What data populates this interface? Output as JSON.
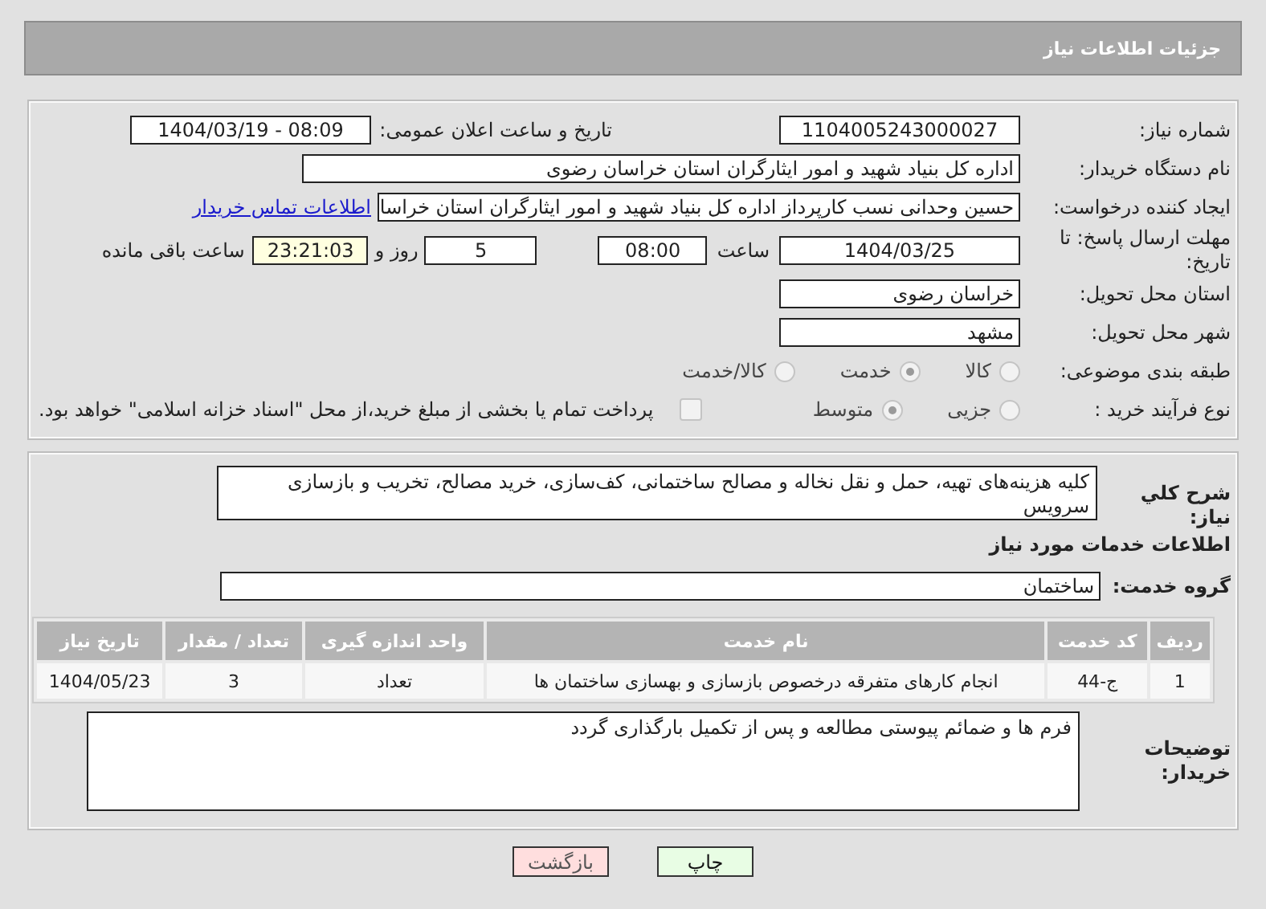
{
  "header": {
    "title": "جزئیات اطلاعات نیاز"
  },
  "need_number": {
    "label": "شماره نیاز:",
    "value": "1104005243000027"
  },
  "announce": {
    "label": "تاریخ و ساعت اعلان عمومی:",
    "value": "1404/03/19 - 08:09"
  },
  "buyer_org": {
    "label": "نام دستگاه خریدار:",
    "value": "اداره کل بنیاد شهید و امور ایثارگران استان خراسان رضوی"
  },
  "requester": {
    "label": "ایجاد کننده درخواست:",
    "value": "حسین وحدانی نسب کارپرداز اداره کل بنیاد شهید و امور ایثارگران استان خراسا",
    "link": "اطلاعات تماس خریدار"
  },
  "deadline": {
    "label": "مهلت ارسال پاسخ: تا تاریخ:",
    "date": "1404/03/25",
    "time_label": "ساعت",
    "time": "08:00",
    "days": "5",
    "days_label": "روز و",
    "remaining": "23:21:03",
    "remaining_label": "ساعت باقی مانده"
  },
  "province": {
    "label": "استان محل تحویل:",
    "value": "خراسان رضوی"
  },
  "city": {
    "label": "شهر محل تحویل:",
    "value": "مشهد"
  },
  "category": {
    "label": "طبقه بندی موضوعی:",
    "options": [
      {
        "label": "کالا",
        "selected": false
      },
      {
        "label": "خدمت",
        "selected": true
      },
      {
        "label": "کالا/خدمت",
        "selected": false
      }
    ]
  },
  "purchase_type": {
    "label": "نوع فرآیند خرید :",
    "options": [
      {
        "label": "جزیی",
        "selected": false
      },
      {
        "label": "متوسط",
        "selected": true
      }
    ],
    "payment_note": {
      "text": "پرداخت تمام یا بخشی از مبلغ خرید،از محل \"اسناد خزانه اسلامی\" خواهد بود.",
      "checked": false
    }
  },
  "description": {
    "label": "شرح کلي نياز:",
    "value": "کلیه هزینه‌های تهیه، حمل و نقل نخاله و مصالح ساختمانی، کف‌سازی، خرید مصالح، تخریب و بازسازی سرویس"
  },
  "services_heading": "اطلاعات خدمات مورد نیاز",
  "service_group": {
    "label": "گروه خدمت:",
    "value": "ساختمان"
  },
  "table": {
    "columns": [
      "ردیف",
      "کد خدمت",
      "نام خدمت",
      "واحد اندازه گیری",
      "تعداد / مقدار",
      "تاریخ نیاز"
    ],
    "rows": [
      [
        "1",
        "ج-44",
        "انجام کارهای متفرقه درخصوص بازسازی و بهسازی ساختمان ها",
        "تعداد",
        "3",
        "1404/05/23"
      ]
    ]
  },
  "buyer_notes": {
    "label": "توضیحات خریدار:",
    "value": "فرم ها و ضمائم پیوستی مطالعه و پس از تکمیل بارگذاری گردد"
  },
  "buttons": [
    {
      "label": "چاپ",
      "kind": "print"
    },
    {
      "label": "بازگشت",
      "kind": "back"
    }
  ]
}
